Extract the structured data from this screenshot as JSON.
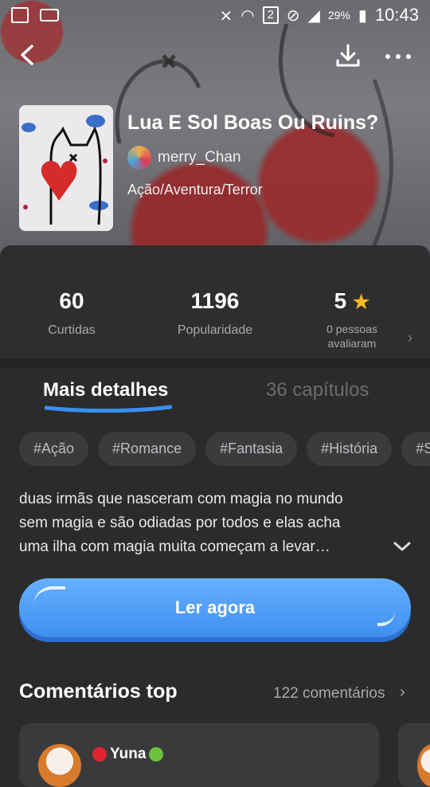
{
  "status_bar": {
    "battery": "29%",
    "time": "10:43",
    "sim": "2"
  },
  "book": {
    "title": "Lua E Sol Boas Ou Ruins?",
    "author": "merry_Chan",
    "genre": "Ação/Aventura/Terror"
  },
  "stats": {
    "likes_value": "60",
    "likes_label": "Curtidas",
    "popularity_value": "1196",
    "popularity_label": "Popularidade",
    "rating_value": "5",
    "rating_label": "0 pessoas avaliaram",
    "rating_label_line1": "0 pessoas",
    "rating_label_line2": "avaliaram"
  },
  "tabs": {
    "details": "Mais detalhes",
    "chapters": "36 capítulos"
  },
  "tags": [
    "#Ação",
    "#Romance",
    "#Fantasia",
    "#História",
    "#S"
  ],
  "description": {
    "line1": "duas irmãs que nasceram com magia no mundo",
    "line2": "sem magia e são odiadas por todos e elas acha",
    "line3": "uma ilha com magia muita começam a levar…"
  },
  "read_button": "Ler agora",
  "comments": {
    "title": "Comentários top",
    "count": "122 comentários",
    "first_author": "Yuna"
  },
  "colors": {
    "accent": "#4a9cff",
    "star": "#f5b921",
    "background": "#2b2b2b"
  }
}
